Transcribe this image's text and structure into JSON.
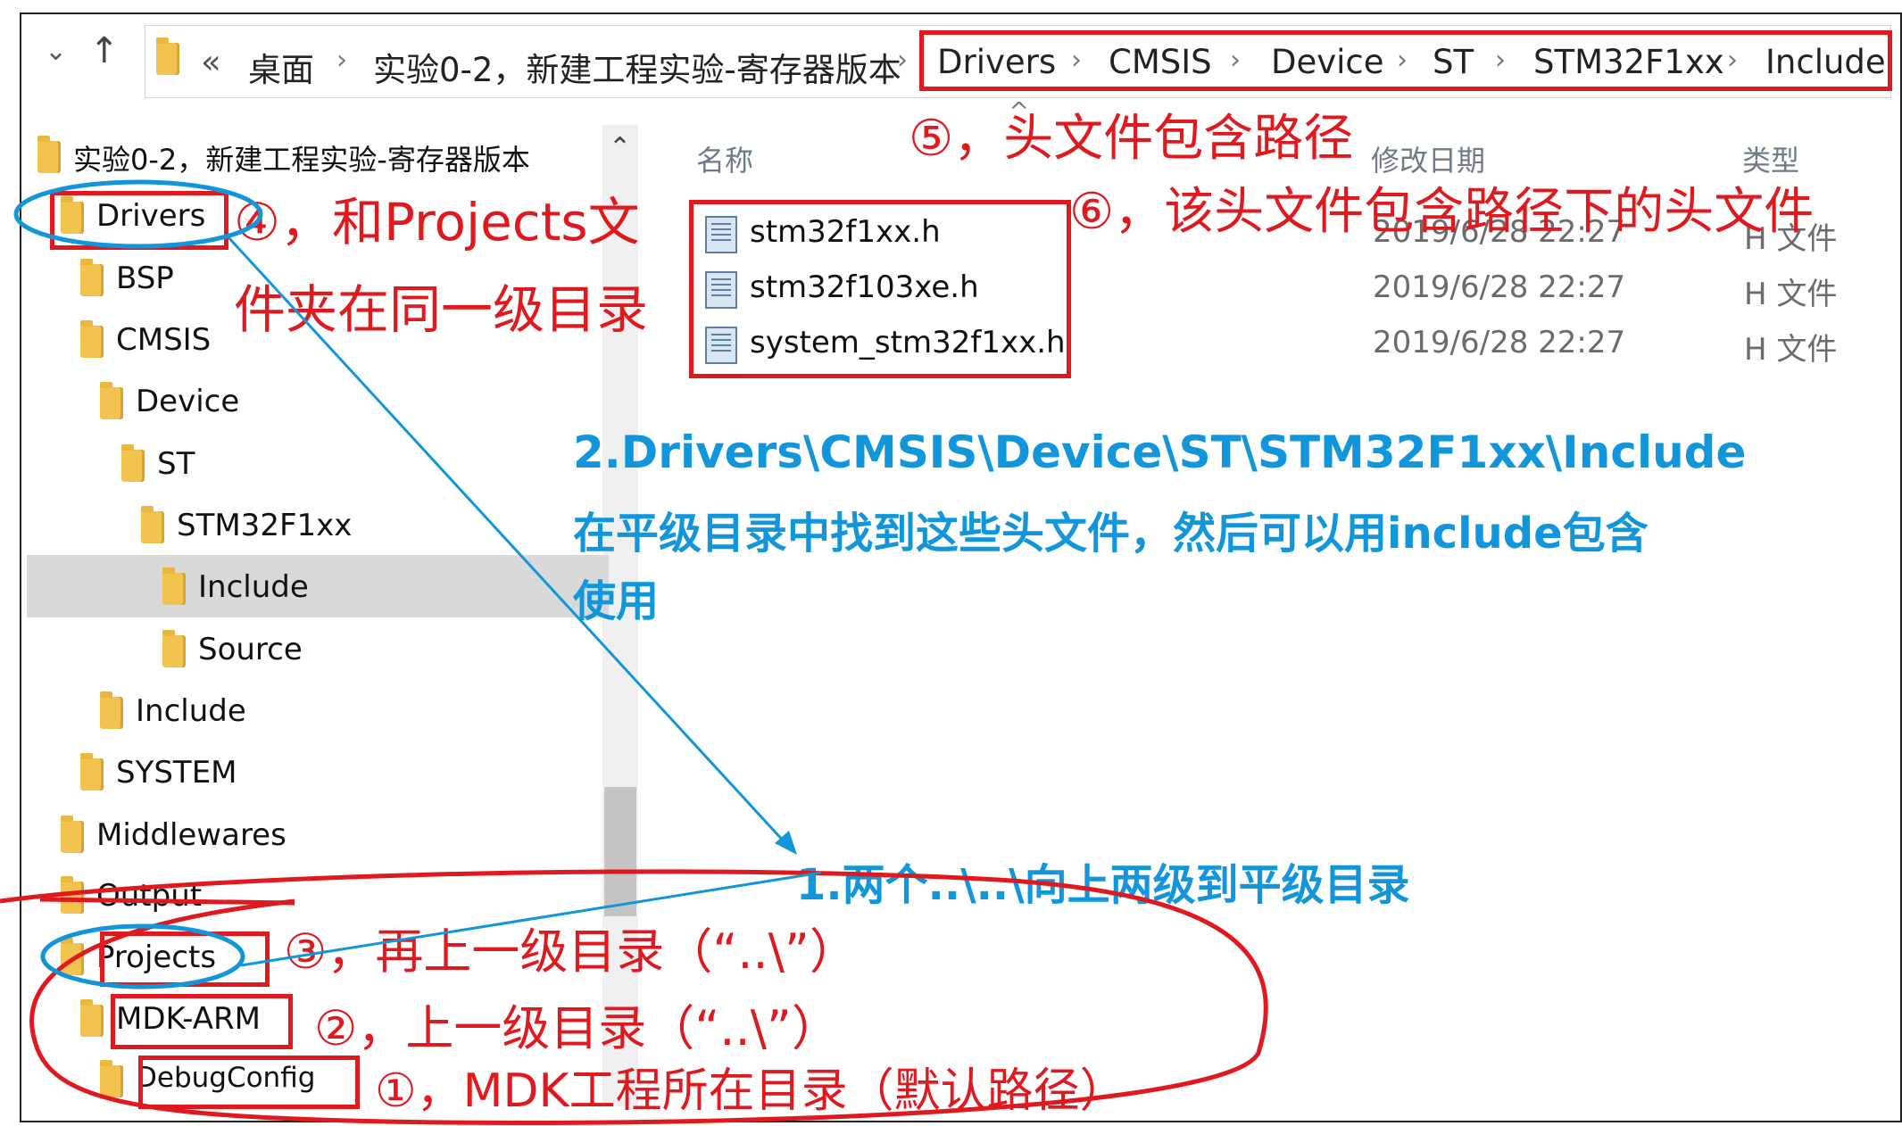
{
  "nav": {
    "back_icon": "chevron-down-icon",
    "up_icon": "up-arrow-icon"
  },
  "address_bar": {
    "overflow": "«",
    "crumbs": [
      "桌面",
      "实验0-2，新建工程实验-寄存器版本",
      "Drivers",
      "CMSIS",
      "Device",
      "ST",
      "STM32F1xx",
      "Include"
    ]
  },
  "tree": {
    "root": "实验0-2，新建工程实验-寄存器版本",
    "items": [
      "Drivers",
      "BSP",
      "CMSIS",
      "Device",
      "ST",
      "STM32F1xx",
      "Include",
      "Source",
      "Include",
      "SYSTEM",
      "Middlewares",
      "Output",
      "Projects",
      "MDK-ARM",
      "DebugConfig"
    ],
    "selected": "Include"
  },
  "columns": {
    "name": "名称",
    "date": "修改日期",
    "type": "类型"
  },
  "files": [
    {
      "name": "stm32f1xx.h",
      "date": "2019/6/28 22:27",
      "type": "H 文件"
    },
    {
      "name": "stm32f103xe.h",
      "date": "2019/6/28 22:27",
      "type": "H 文件"
    },
    {
      "name": "system_stm32f1xx.h",
      "date": "2019/6/28 22:27",
      "type": "H 文件"
    }
  ],
  "annotations": {
    "a1": "①，MDK工程所在目录（默认路径）",
    "a2": "②，上一级目录（“..\\”）",
    "a3": "③，再上一级目录（“..\\”）",
    "a4_line1": "④，和Projects文",
    "a4_line2": "件夹在同一级目录",
    "a5": "⑤，头文件包含路径",
    "a6": "⑥，该头文件包含路径下的头文件",
    "blue1": "1.两个..\\..\\向上两级到平级目录",
    "blue2_line1": "2.Drivers\\CMSIS\\Device\\ST\\STM32F1xx\\Include",
    "blue2_line2": "在平级目录中找到这些头文件，然后可以用include包含",
    "blue2_line3": "使用"
  },
  "colors": {
    "annotation_red": "#e0191f",
    "annotation_blue": "#1296db",
    "folder": "#f2c34e"
  }
}
